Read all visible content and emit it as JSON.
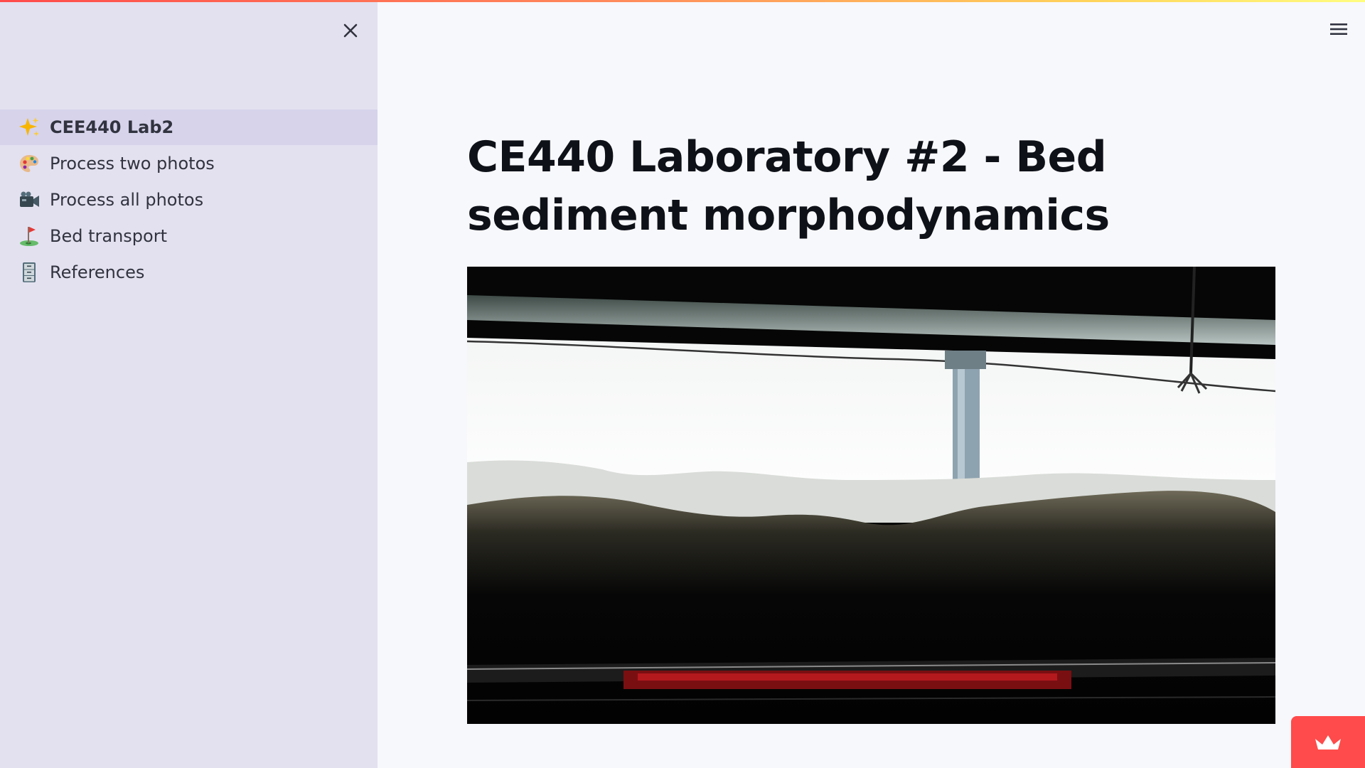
{
  "sidebar": {
    "items": [
      {
        "label": "CEE440 Lab2",
        "icon": "sparkles-icon",
        "active": true
      },
      {
        "label": "Process two photos",
        "icon": "palette-icon",
        "active": false
      },
      {
        "label": "Process all photos",
        "icon": "video-camera-icon",
        "active": false
      },
      {
        "label": "Bed transport",
        "icon": "golf-flag-icon",
        "active": false
      },
      {
        "label": "References",
        "icon": "file-cabinet-icon",
        "active": false
      }
    ]
  },
  "main": {
    "title": "CE440 Laboratory #2 - Bed sediment morphodynamics",
    "image_alt": "Flume sediment bed photo"
  },
  "colors": {
    "sidebar_bg": "#e3e1f0",
    "active_item_bg": "#d6d3eb",
    "main_bg": "#f7f8fc",
    "accent": "#ff4b4b"
  }
}
